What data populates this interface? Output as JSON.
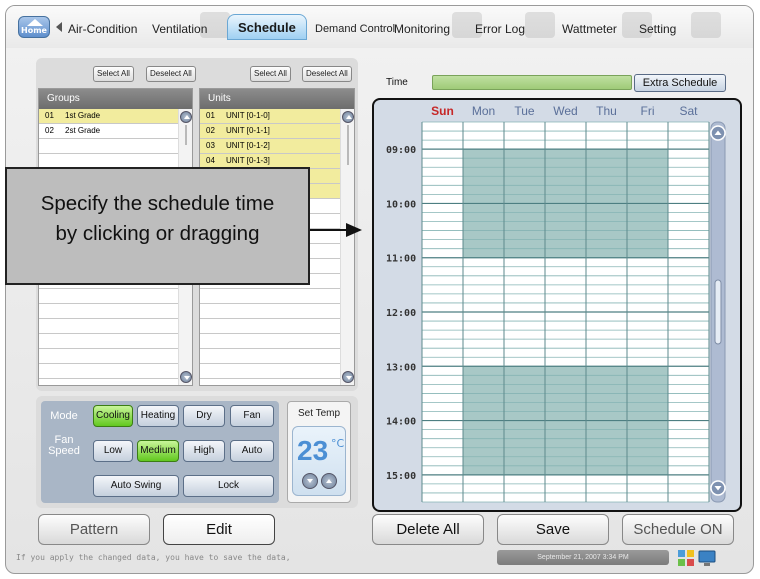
{
  "nav": {
    "home_label": "Home",
    "tabs": [
      {
        "label": "Air-Condition"
      },
      {
        "label": "Ventilation"
      },
      {
        "label": "Schedule",
        "active": true
      },
      {
        "label": "Demand Control"
      },
      {
        "label": "Monitoring"
      },
      {
        "label": "Error Log"
      },
      {
        "label": "Wattmeter"
      },
      {
        "label": "Setting"
      }
    ]
  },
  "groups_panel": {
    "select_all": "Select All",
    "deselect_all": "Deselect All",
    "header": "Groups",
    "rows": [
      {
        "no": "01",
        "name": "1st Grade",
        "selected": true
      },
      {
        "no": "02",
        "name": "2st Grade",
        "selected": false
      }
    ]
  },
  "units_panel": {
    "select_all": "Select All",
    "deselect_all": "Deselect All",
    "header": "Units",
    "rows": [
      {
        "no": "01",
        "name": "UNIT [0-1-0]",
        "selected": true
      },
      {
        "no": "02",
        "name": "UNIT [0-1-1]",
        "selected": true
      },
      {
        "no": "03",
        "name": "UNIT [0-1-2]",
        "selected": true
      },
      {
        "no": "04",
        "name": "UNIT [0-1-3]",
        "selected": true
      }
    ]
  },
  "mode_panel": {
    "mode_label": "Mode",
    "modes": [
      {
        "label": "Cooling",
        "on": true
      },
      {
        "label": "Heating",
        "on": false
      },
      {
        "label": "Dry",
        "on": false
      },
      {
        "label": "Fan",
        "on": false
      }
    ],
    "fan_speed_label": "Fan Speed",
    "fan_speeds": [
      {
        "label": "Low",
        "on": false
      },
      {
        "label": "Medium",
        "on": true
      },
      {
        "label": "High",
        "on": false
      },
      {
        "label": "Auto",
        "on": false
      }
    ],
    "auto_swing": "Auto Swing",
    "lock": "Lock",
    "set_temp_label": "Set Temp",
    "set_temp_value": "23",
    "set_temp_unit": "°C"
  },
  "schedule": {
    "time_label": "Time",
    "extra_schedule": "Extra Schedule",
    "days": [
      "Sun",
      "Mon",
      "Tue",
      "Wed",
      "Thu",
      "Fri",
      "Sat"
    ],
    "day_colors": {
      "Sun": "#c62828",
      "weekday": "#5a6f99"
    },
    "hours": [
      "09:00",
      "10:00",
      "11:00",
      "12:00",
      "13:00",
      "14:00",
      "15:00"
    ],
    "visible_start": "08:30",
    "visible_end": "15:30",
    "blocks": [
      {
        "days": [
          "Mon",
          "Tue",
          "Wed",
          "Thu",
          "Fri"
        ],
        "start": "09:00",
        "end": "11:00"
      },
      {
        "days": [
          "Mon",
          "Tue",
          "Wed",
          "Thu",
          "Fri"
        ],
        "start": "13:00",
        "end": "15:00"
      }
    ],
    "block_color": "#a8c8c6",
    "grid_color": "#86b4b4"
  },
  "bottom": {
    "pattern": "Pattern",
    "edit": "Edit",
    "delete_all": "Delete All",
    "save": "Save",
    "schedule_on": "Schedule ON",
    "status_message": "If you apply the changed data,  you have to save the data,",
    "datetime": "September 21, 2007 3:34 PM"
  },
  "callout": {
    "line1": "Specify the schedule time",
    "line2": "by clicking or dragging"
  }
}
